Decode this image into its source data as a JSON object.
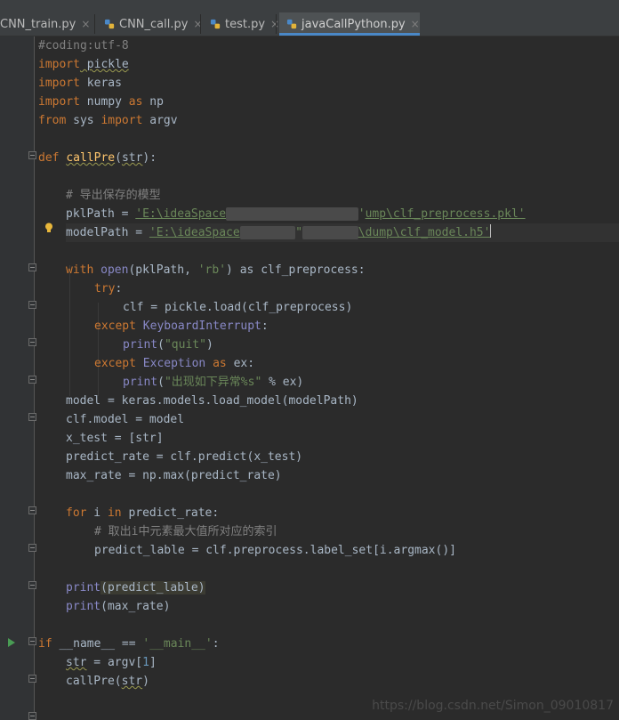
{
  "tabs": [
    {
      "label": "CNN_train.py",
      "close": "×"
    },
    {
      "label": "CNN_call.py",
      "close": "×"
    },
    {
      "label": "test.py",
      "close": "×"
    },
    {
      "label": "javaCallPython.py",
      "close": "×",
      "active": true
    }
  ],
  "code": {
    "l1": "#coding:utf-8",
    "l2_kw": "import",
    "l2_mod": " pickle",
    "l3_kw": "import",
    "l3_mod": " keras",
    "l4_kw": "import",
    "l4_mod": " numpy ",
    "l4_as": "as",
    "l4_alias": " np",
    "l5_from": "from",
    "l5_mod": " sys ",
    "l5_import": "import",
    "l5_name": " argv",
    "l7_def": "def ",
    "l7_name": "callPre",
    "l7_open": "(",
    "l7_param": "str",
    "l7_close": "):",
    "l9_comment": "# 导出保存的模型",
    "l10_var": "pklPath = ",
    "l10_str_a": "'E:\\ideaSpace",
    "l10_str_b": "'",
    "l10_str_c": "ump\\clf_preprocess.pkl'",
    "l11_var": "modelPath = ",
    "l11_str_a": "'E:\\ideaSpace",
    "l11_str_b": "\"",
    "l11_str_c": "\\dump\\clf_model.h5'",
    "l13_with": "with ",
    "l13_open": "open",
    "l13_args": "(pklPath, ",
    "l13_mode": "'rb'",
    "l13_as": ") as ",
    "l13_rest": "clf_preprocess:",
    "l14_try": "try",
    "l14_colon": ":",
    "l15": "clf = pickle.load(clf_preprocess)",
    "l16_except": "except ",
    "l16_exc": "KeyboardInterrupt",
    "l16_colon": ":",
    "l17_print": "print",
    "l17_open": "(",
    "l17_str": "\"quit\"",
    "l17_close": ")",
    "l18_except": "except ",
    "l18_exc": "Exception",
    "l18_as": " as ",
    "l18_rest": "ex:",
    "l19_print": "print",
    "l19_open": "(",
    "l19_str": "\"出现如下异常%s\"",
    "l19_rest": " % ex)",
    "l20": "model = keras.models.load_model(modelPath)",
    "l21": "clf.model = model",
    "l22": "x_test = [str]",
    "l23": "predict_rate = clf.predict(x_test)",
    "l24": "max_rate = np.max(predict_rate)",
    "l26_for": "for",
    "l26_i": " i ",
    "l26_in": "in",
    "l26_rest": " predict_rate:",
    "l27_comment": "# 取出i中元素最大值所对应的索引",
    "l28": "predict_lable = clf.preprocess.label_set[i.argmax()]",
    "l30_print": "print",
    "l30_open": "(",
    "l30_arg": "predict_lable",
    "l30_close": ")",
    "l31_print": "print",
    "l31_rest": "(max_rate)",
    "l33_if": "if",
    "l33_name": " __name__ == ",
    "l33_str": "'__main__'",
    "l33_colon": ":",
    "l34_str": "str",
    "l34_open": " = argv[",
    "l34_num": "1",
    "l34_close": "]",
    "l35_call": "callPre(",
    "l35_arg": "str",
    "l35_close": ")"
  },
  "watermark": "https://blog.csdn.net/Simon_09010817",
  "colors": {
    "keyword": "#cc7832",
    "string": "#6a8759",
    "comment": "#808080",
    "function": "#ffc66d",
    "builtin": "#8888c6",
    "number": "#6897bb"
  }
}
